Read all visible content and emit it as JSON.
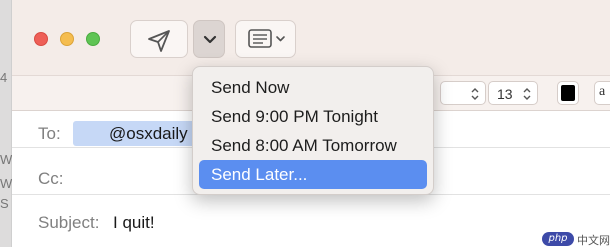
{
  "background_window": {
    "fragments": [
      "4",
      "W",
      "W",
      "S"
    ]
  },
  "toolbar": {
    "send_icon": "paper-plane-icon",
    "send_options_icon": "chevron-down-icon",
    "header_fields_icon": "list-icon"
  },
  "format_bar": {
    "font_size": "13",
    "text_color": "#000000",
    "text_color_glyph": "a"
  },
  "fields": {
    "to_label": "To:",
    "to_recipient": "@osxdaily",
    "cc_label": "Cc:",
    "subject_label": "Subject:",
    "subject_value": "I quit!"
  },
  "send_menu": {
    "items": [
      {
        "label": "Send Now",
        "highlighted": false
      },
      {
        "label": "Send 9:00 PM Tonight",
        "highlighted": false
      },
      {
        "label": "Send 8:00 AM Tomorrow",
        "highlighted": false
      },
      {
        "label": "Send Later...",
        "highlighted": true
      }
    ]
  },
  "watermark": {
    "badge": "php",
    "text": "中文网"
  },
  "colors": {
    "close": "#ee5f57",
    "minimize": "#f5bd4f",
    "zoom": "#5fc454",
    "menu_highlight": "#5b8ef0",
    "recipient_token": "#c6d8f6"
  }
}
